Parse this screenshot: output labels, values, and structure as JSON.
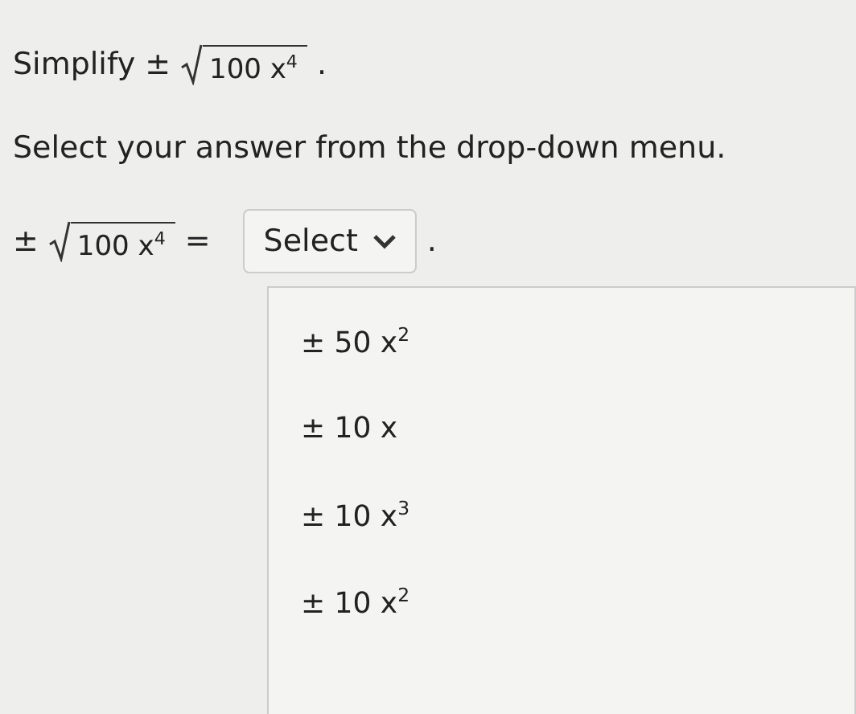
{
  "prompt": {
    "verb": "Simplify",
    "sign": "±",
    "radicand": "100 x$^{4}$",
    "end": "."
  },
  "instruction": "Select your answer from the drop-down menu.",
  "equation": {
    "sign": "±",
    "radicand": "100 x$^{4}$",
    "equals": "="
  },
  "dropdown": {
    "value": "Select",
    "expanded": true,
    "end": ".",
    "options": [
      {
        "label": "± 50 x$^{2}$",
        "selected": false
      },
      {
        "label": "± 10 x",
        "selected": false
      },
      {
        "label": "± 10 x$^{3}$",
        "selected": false
      },
      {
        "label": "± 10 x$^{2}$",
        "selected": false
      }
    ]
  }
}
